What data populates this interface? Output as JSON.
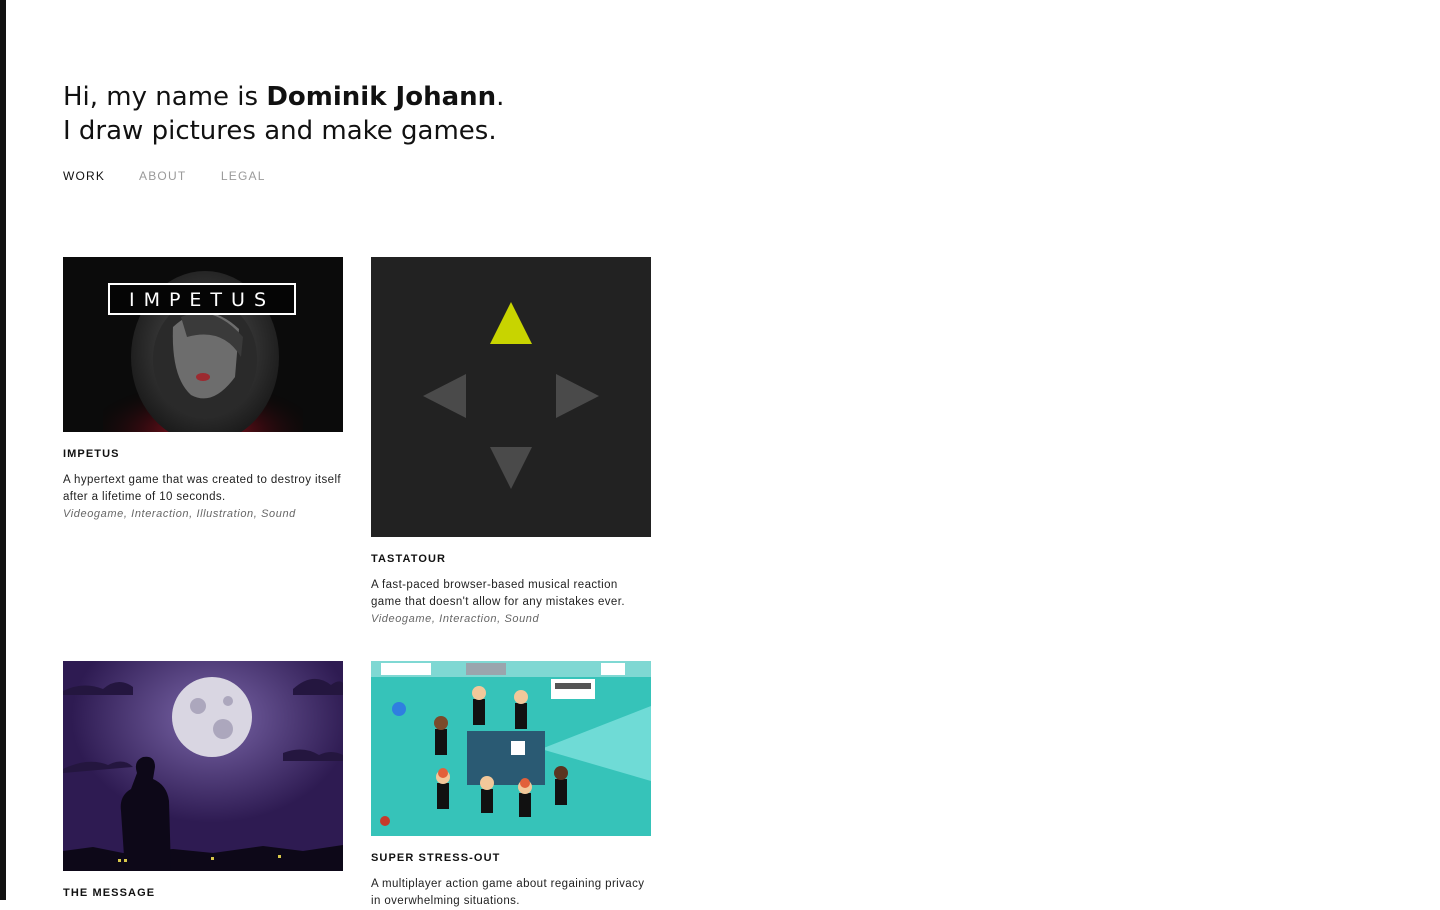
{
  "intro": {
    "line1_prefix": "Hi, my name is ",
    "name": "Dominik Johann",
    "line1_suffix": ".",
    "line2": "I draw pictures and make games."
  },
  "nav": {
    "work": "WORK",
    "about": "ABOUT",
    "legal": "LEGAL"
  },
  "projects": [
    {
      "logo": "IMPETUS",
      "title": "IMPETUS",
      "description": "A hypertext game that was created to destroy itself after a lifetime of 10 seconds.",
      "tags": "Videogame, Interaction, Illustration, Sound"
    },
    {
      "title": "TASTATOUR",
      "description": "A fast-paced browser-based musical reaction game that doesn't allow for any mistakes ever.",
      "tags": "Videogame, Interaction, Sound"
    },
    {
      "title": "THE MESSAGE"
    },
    {
      "title": "SUPER STRESS-OUT",
      "description": "A multiplayer action game about regaining privacy in overwhelming situations."
    }
  ],
  "colors": {
    "accent_arrow": "#c8d400",
    "tastatour_bg": "#222222",
    "stressout_teal": "#36c3b9",
    "message_purple": "#3b2563"
  }
}
